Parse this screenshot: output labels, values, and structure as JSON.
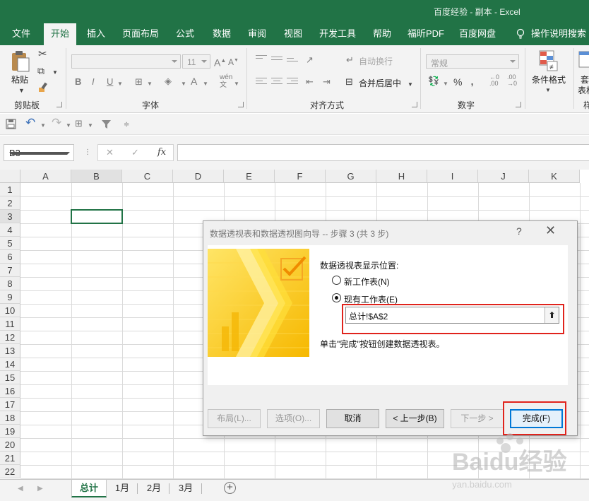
{
  "window": {
    "title": "百度经验 - 副本  -  Excel"
  },
  "ribbon_tabs": [
    "文件",
    "开始",
    "插入",
    "页面布局",
    "公式",
    "数据",
    "审阅",
    "视图",
    "开发工具",
    "帮助",
    "福昕PDF",
    "百度网盘",
    "操作说明搜索"
  ],
  "ribbon": {
    "clipboard": {
      "paste_label": "粘贴",
      "group_label": "剪贴板"
    },
    "font": {
      "font_size": "11",
      "group_label": "字体"
    },
    "alignment": {
      "wrap_text": "自动换行",
      "merge_center": "合并后居中",
      "group_label": "对齐方式"
    },
    "number": {
      "format": "常规",
      "group_label": "数字"
    },
    "styles": {
      "conditional_format": "条件格式",
      "table_format_1": "套",
      "table_format_2": "表格格",
      "more": "样"
    }
  },
  "formula_bar": {
    "name_box": "B3",
    "fx": "fx",
    "cancel": "✕",
    "enter": "✓"
  },
  "grid": {
    "columns": [
      "A",
      "B",
      "C",
      "D",
      "E",
      "F",
      "G",
      "H",
      "I",
      "J",
      "K"
    ],
    "rows": [
      "1",
      "2",
      "3",
      "4",
      "5",
      "6",
      "7",
      "8",
      "9",
      "10",
      "11",
      "12",
      "13",
      "14",
      "15",
      "16",
      "17",
      "18",
      "19",
      "20",
      "21",
      "22"
    ]
  },
  "sheets": {
    "tabs": [
      "总计",
      "1月",
      "2月",
      "3月"
    ],
    "active": "总计",
    "add": "+"
  },
  "dialog": {
    "title": "数据透视表和数据透视图向导 -- 步骤 3 (共 3 步)",
    "help": "?",
    "close": "✕",
    "location_label": "数据透视表显示位置:",
    "option_new": "新工作表(N)",
    "option_existing": "现有工作表(E)",
    "selected_option": "existing",
    "reference": "总计!$A$2",
    "hint": "单击\"完成\"按钮创建数据透视表。",
    "buttons": {
      "layout": "布局(L)...",
      "options": "选项(O)...",
      "cancel": "取消",
      "back": "< 上一步(B)",
      "next": "下一步 >",
      "finish": "完成(F)"
    }
  },
  "watermark": {
    "brand": "Baidu经验",
    "url": "jingyan.baidu.com"
  },
  "colors": {
    "excel_green": "#217346",
    "highlight_red": "#e0231c",
    "focus_blue": "#0078d7"
  }
}
